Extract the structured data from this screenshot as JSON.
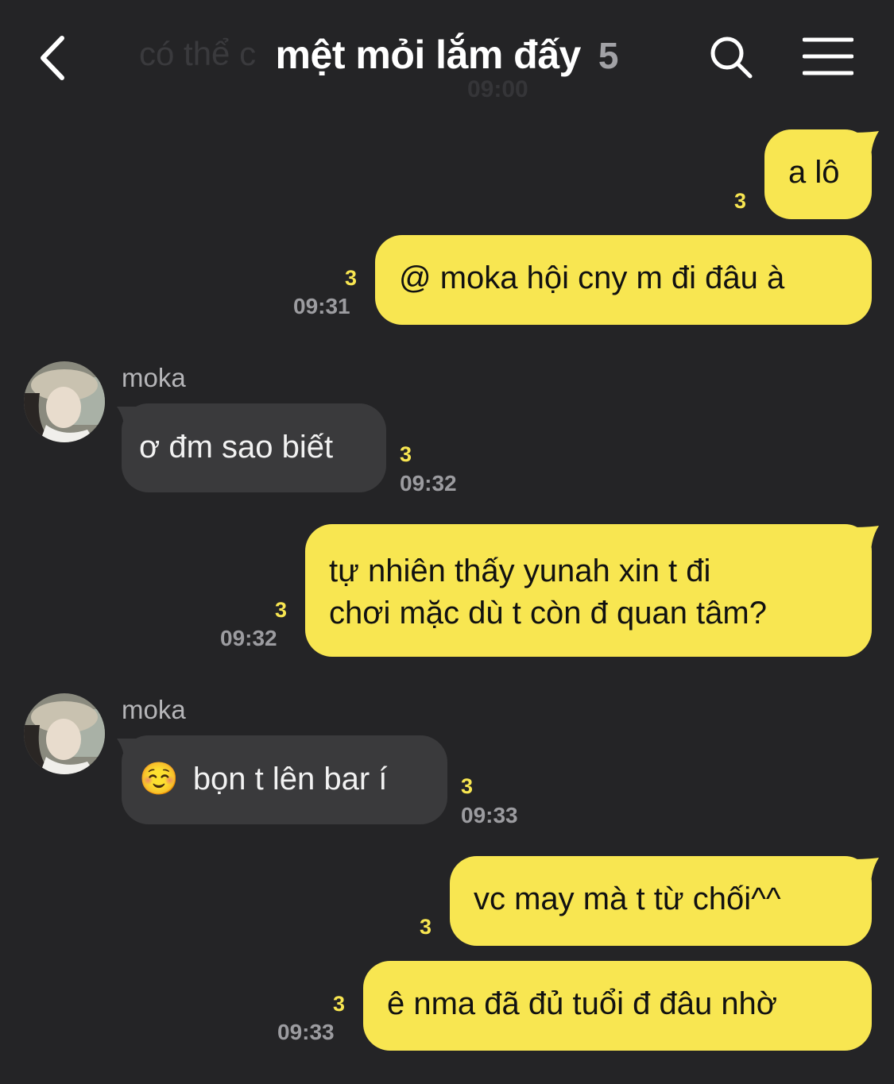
{
  "header": {
    "back_label": "back",
    "title": "mệt mỏi lắm đấy",
    "member_count": "5",
    "ghost_text": "có thể c",
    "ghost_time": "09:00",
    "search_icon": "search-icon",
    "menu_icon": "menu-icon"
  },
  "messages": [
    {
      "side": "mine",
      "text": "a lô",
      "unread": "3",
      "time": ""
    },
    {
      "side": "mine",
      "text": "@ moka hội cny m đi đâu à",
      "unread": "3",
      "time": "09:31"
    },
    {
      "side": "theirs",
      "sender": "moka",
      "text": "ơ đm sao biết",
      "unread": "3",
      "time": "09:32"
    },
    {
      "side": "mine",
      "text_line1": "tự nhiên thấy yunah xin t đi",
      "text_line2": "chơi mặc dù t còn đ quan tâm?",
      "unread": "3",
      "time": "09:32"
    },
    {
      "side": "theirs",
      "sender": "moka",
      "emoji": "☺️",
      "text": "bọn t lên bar í",
      "unread": "3",
      "time": "09:33"
    },
    {
      "side": "mine",
      "text": "vc may mà t từ chối^^",
      "unread": "3",
      "time": ""
    },
    {
      "side": "mine",
      "text": "ê nma đã đủ tuổi đ đâu nhờ",
      "unread": "3",
      "time": "09:33"
    }
  ],
  "colors": {
    "background": "#242426",
    "my_bubble": "#f8e651",
    "their_bubble": "#3a3a3c",
    "unread": "#f8e651",
    "time": "#9c9ca0"
  }
}
